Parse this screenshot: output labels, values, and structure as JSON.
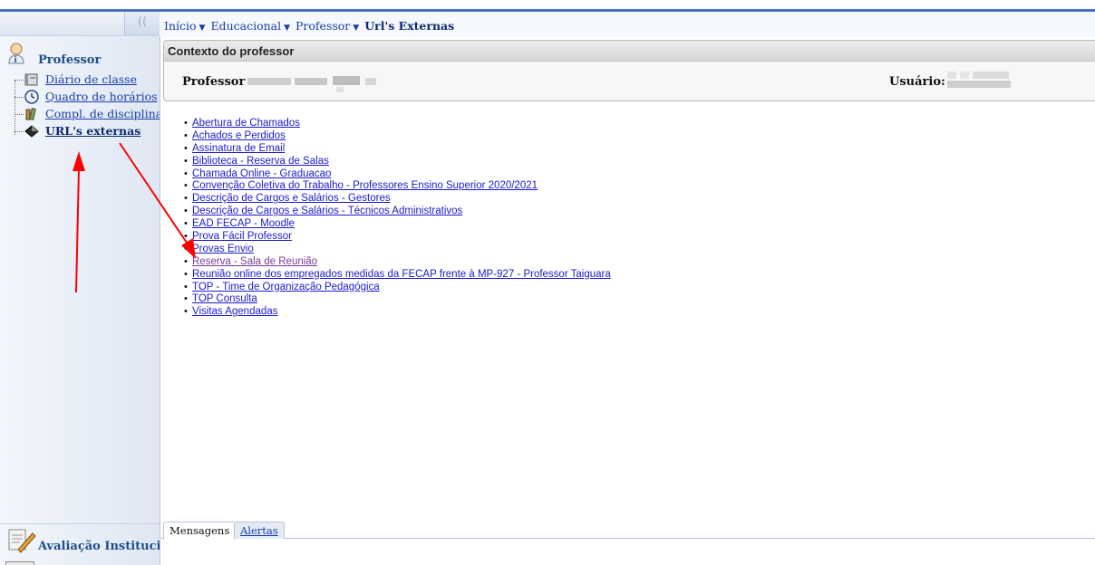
{
  "sidebar": {
    "collapse_label": "((",
    "section_title": "Professor",
    "items": [
      {
        "label": "Diário de classe",
        "icon": "book-icon",
        "active": false
      },
      {
        "label": "Quadro de horários",
        "icon": "clock-icon",
        "active": false
      },
      {
        "label": "Compl. de disciplina",
        "icon": "books-icon",
        "active": false
      },
      {
        "label": "URL's externas",
        "icon": "diamond-icon",
        "active": true
      }
    ],
    "bottom_section_title": "Avaliação Institucional"
  },
  "breadcrumb": {
    "items": [
      "Início",
      "Educacional",
      "Professor"
    ],
    "current": "Url's Externas"
  },
  "context": {
    "title": "Contexto do professor",
    "professor_label": "Professor",
    "usuario_label": "Usuário:"
  },
  "links": [
    {
      "label": "Abertura de Chamados",
      "visited": false
    },
    {
      "label": "Achados e Perdidos",
      "visited": false
    },
    {
      "label": "Assinatura de Email",
      "visited": false
    },
    {
      "label": "Biblioteca - Reserva de Salas",
      "visited": false
    },
    {
      "label": "Chamada Online - Graduacao",
      "visited": false
    },
    {
      "label": "Convenção Coletiva do Trabalho - Professores Ensino Superior 2020/2021",
      "visited": false
    },
    {
      "label": "Descrição de Cargos e Salários - Gestores",
      "visited": false
    },
    {
      "label": "Descrição de Cargos e Salários - Técnicos Administrativos",
      "visited": false
    },
    {
      "label": "EAD FECAP - Moodle",
      "visited": false
    },
    {
      "label": "Prova Fácil Professor",
      "visited": false
    },
    {
      "label": "Provas Envio",
      "visited": false
    },
    {
      "label": "Reserva - Sala de Reunião",
      "visited": true
    },
    {
      "label": "Reunião online dos empregados medidas da FECAP frente à MP-927 - Professor Taiguara",
      "visited": false
    },
    {
      "label": "TOP - Time de Organização Pedagógica",
      "visited": false
    },
    {
      "label": "TOP Consulta",
      "visited": false
    },
    {
      "label": "Visitas Agendadas",
      "visited": false
    }
  ],
  "tabs": [
    {
      "label": "Mensagens",
      "active": true
    },
    {
      "label": "Alertas",
      "active": false
    }
  ],
  "colors": {
    "accent": "#4a72b8",
    "link": "#1a1acc",
    "visited_link": "#7a3a9a",
    "annotation_arrow": "#ff0000"
  }
}
